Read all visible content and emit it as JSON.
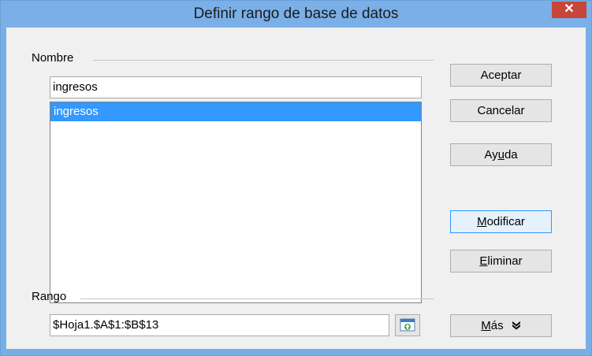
{
  "window": {
    "title": "Definir rango de base de datos",
    "close_label": "✕"
  },
  "name_section": {
    "legend": "Nombre",
    "input_value": "ingresos",
    "list_items": [
      {
        "label": "ingresos",
        "selected": true
      }
    ]
  },
  "range_section": {
    "legend": "Rango",
    "input_value": "$Hoja1.$A$1:$B$13",
    "shrink_icon": "shrink-range-icon"
  },
  "buttons": {
    "ok": "Aceptar",
    "cancel": "Cancelar",
    "help_pre": "Ay",
    "help_mnemonic": "u",
    "help_post": "da",
    "modify_mnemonic": "M",
    "modify_post": "odificar",
    "delete_mnemonic": "E",
    "delete_post": "liminar",
    "more_mnemonic": "M",
    "more_post": "ás",
    "more_icon": "double-chevron-down-icon"
  },
  "colors": {
    "titlebar": "#7aafe8",
    "close_button": "#c7463a",
    "selection": "#3399ff"
  }
}
